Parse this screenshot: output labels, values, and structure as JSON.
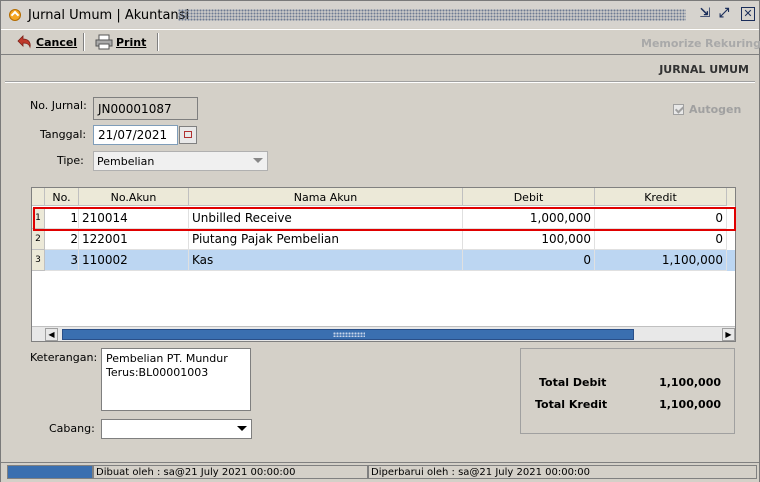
{
  "window": {
    "title": "Jurnal Umum | Akuntansi"
  },
  "toolbar": {
    "cancel_label": "Cancel",
    "print_label": "Print",
    "memorize_label": "Memorize",
    "rekuring_label": "Rekuring"
  },
  "form": {
    "module_title": "JURNAL UMUM",
    "no_jurnal_label": "No. Jurnal:",
    "no_jurnal_value": "JN00001087",
    "tanggal_label": "Tanggal:",
    "tanggal_value": "21/07/2021",
    "tipe_label": "Tipe:",
    "tipe_value": "Pembelian",
    "autogen_label": "Autogen",
    "autogen_checked": true
  },
  "grid": {
    "columns": [
      "No.",
      "No.Akun",
      "Nama Akun",
      "Debit",
      "Kredit"
    ],
    "rows": [
      {
        "row": "1",
        "no": "1",
        "akun": "210014",
        "nama": "Unbilled Receive",
        "debit": "1,000,000",
        "kredit": "0"
      },
      {
        "row": "2",
        "no": "2",
        "akun": "122001",
        "nama": "Piutang Pajak Pembelian",
        "debit": "100,000",
        "kredit": "0"
      },
      {
        "row": "3",
        "no": "3",
        "akun": "110002",
        "nama": "Kas",
        "debit": "0",
        "kredit": "1,100,000"
      }
    ],
    "selected_row_color": "#bcd6f2",
    "highlight_color": "#e00000"
  },
  "keterangan": {
    "label": "Keterangan:",
    "line1": "Pembelian PT. Mundur",
    "line2": "Terus:BL00001003"
  },
  "cabang": {
    "label": "Cabang:",
    "value": ""
  },
  "totals": {
    "total_debit_label": "Total Debit",
    "total_debit_value": "1,100,000",
    "total_kredit_label": "Total Kredit",
    "total_kredit_value": "1,100,000"
  },
  "status": {
    "created": "Dibuat oleh : sa@21 July 2021  00:00:00",
    "updated": "Diperbarui oleh : sa@21 July 2021  00:00:00"
  }
}
